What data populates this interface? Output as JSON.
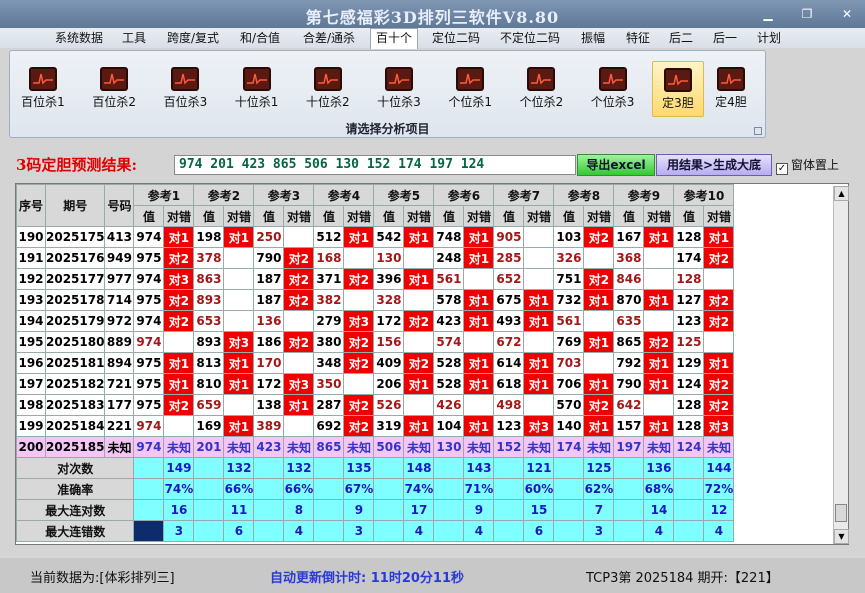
{
  "window": {
    "title": "第七感福彩3D排列三软件V8.80"
  },
  "menu": [
    "系统数据",
    "工具",
    "跨度/复式",
    "和/合值",
    "合差/通杀",
    "百十个",
    "定位二码",
    "不定位二码",
    "振幅",
    "特征",
    "后二",
    "后一",
    "计划"
  ],
  "menu_active": "百十个",
  "ribbon": {
    "buttons": [
      "百位杀1",
      "百位杀2",
      "百位杀3",
      "十位杀1",
      "十位杀2",
      "十位杀3",
      "个位杀1",
      "个位杀2",
      "个位杀3",
      "定3胆",
      "定4胆"
    ],
    "selected": "定3胆",
    "caption": "请选择分析项目"
  },
  "prediction": {
    "label": "3码定胆预测结果:",
    "value": "974 201 423 865 506 130 152 174 197 124",
    "export_label": "导出excel",
    "generate_label": "用结果>生成大底",
    "ontop_label": "窗体置上",
    "ontop_checked": "✓"
  },
  "table": {
    "head_idx": "序号",
    "head_period": "期号",
    "head_num": "号码",
    "refs": [
      "参考1",
      "参考2",
      "参考3",
      "参考4",
      "参考5",
      "参考6",
      "参考7",
      "参考8",
      "参考9",
      "参考10"
    ],
    "sub_val": "值",
    "sub_hit": "对错",
    "rows": [
      {
        "idx": "190",
        "period": "2025175",
        "num": "413",
        "cells": [
          [
            "974",
            "对1",
            0
          ],
          [
            "198",
            "对1",
            0
          ],
          [
            "250",
            "",
            1
          ],
          [
            "512",
            "对1",
            0
          ],
          [
            "542",
            "对1",
            0
          ],
          [
            "748",
            "对1",
            0
          ],
          [
            "905",
            "",
            1
          ],
          [
            "103",
            "对2",
            0
          ],
          [
            "167",
            "对1",
            0
          ],
          [
            "128",
            "对1",
            0
          ]
        ]
      },
      {
        "idx": "191",
        "period": "2025176",
        "num": "949",
        "cells": [
          [
            "975",
            "对2",
            0
          ],
          [
            "378",
            "",
            1
          ],
          [
            "790",
            "对2",
            0
          ],
          [
            "168",
            "",
            1
          ],
          [
            "130",
            "",
            1
          ],
          [
            "248",
            "对1",
            0
          ],
          [
            "285",
            "",
            1
          ],
          [
            "326",
            "",
            1
          ],
          [
            "368",
            "",
            1
          ],
          [
            "174",
            "对2",
            0
          ]
        ]
      },
      {
        "idx": "192",
        "period": "2025177",
        "num": "977",
        "cells": [
          [
            "974",
            "对3",
            0
          ],
          [
            "863",
            "",
            1
          ],
          [
            "187",
            "对2",
            0
          ],
          [
            "371",
            "对2",
            0
          ],
          [
            "396",
            "对1",
            0
          ],
          [
            "561",
            "",
            1
          ],
          [
            "652",
            "",
            1
          ],
          [
            "751",
            "对2",
            0
          ],
          [
            "846",
            "",
            1
          ],
          [
            "128",
            "",
            1
          ]
        ]
      },
      {
        "idx": "193",
        "period": "2025178",
        "num": "714",
        "cells": [
          [
            "975",
            "对2",
            0
          ],
          [
            "893",
            "",
            1
          ],
          [
            "187",
            "对2",
            0
          ],
          [
            "382",
            "",
            1
          ],
          [
            "328",
            "",
            1
          ],
          [
            "578",
            "对1",
            0
          ],
          [
            "675",
            "对1",
            0
          ],
          [
            "732",
            "对1",
            0
          ],
          [
            "870",
            "对1",
            0
          ],
          [
            "127",
            "对2",
            0
          ]
        ]
      },
      {
        "idx": "194",
        "period": "2025179",
        "num": "972",
        "cells": [
          [
            "974",
            "对2",
            0
          ],
          [
            "653",
            "",
            1
          ],
          [
            "136",
            "",
            1
          ],
          [
            "279",
            "对3",
            0
          ],
          [
            "172",
            "对2",
            0
          ],
          [
            "423",
            "对1",
            0
          ],
          [
            "493",
            "对1",
            0
          ],
          [
            "561",
            "",
            1
          ],
          [
            "635",
            "",
            1
          ],
          [
            "123",
            "对2",
            0
          ]
        ]
      },
      {
        "idx": "195",
        "period": "2025180",
        "num": "889",
        "cells": [
          [
            "974",
            "",
            1
          ],
          [
            "893",
            "对3",
            0
          ],
          [
            "186",
            "对2",
            0
          ],
          [
            "380",
            "对2",
            0
          ],
          [
            "156",
            "",
            1
          ],
          [
            "574",
            "",
            1
          ],
          [
            "672",
            "",
            1
          ],
          [
            "769",
            "对1",
            0
          ],
          [
            "865",
            "对2",
            0
          ],
          [
            "125",
            "",
            1
          ]
        ]
      },
      {
        "idx": "196",
        "period": "2025181",
        "num": "894",
        "cells": [
          [
            "975",
            "对1",
            0
          ],
          [
            "813",
            "对1",
            0
          ],
          [
            "170",
            "",
            1
          ],
          [
            "348",
            "对2",
            0
          ],
          [
            "409",
            "对2",
            0
          ],
          [
            "528",
            "对1",
            0
          ],
          [
            "614",
            "对1",
            0
          ],
          [
            "703",
            "",
            1
          ],
          [
            "792",
            "对1",
            0
          ],
          [
            "129",
            "对1",
            0
          ]
        ]
      },
      {
        "idx": "197",
        "period": "2025182",
        "num": "721",
        "cells": [
          [
            "975",
            "对1",
            0
          ],
          [
            "810",
            "对1",
            0
          ],
          [
            "172",
            "对3",
            0
          ],
          [
            "350",
            "",
            1
          ],
          [
            "206",
            "对1",
            0
          ],
          [
            "528",
            "对1",
            0
          ],
          [
            "618",
            "对1",
            0
          ],
          [
            "706",
            "对1",
            0
          ],
          [
            "790",
            "对1",
            0
          ],
          [
            "124",
            "对2",
            0
          ]
        ]
      },
      {
        "idx": "198",
        "period": "2025183",
        "num": "177",
        "cells": [
          [
            "975",
            "对2",
            0
          ],
          [
            "659",
            "",
            1
          ],
          [
            "138",
            "对1",
            0
          ],
          [
            "287",
            "对2",
            0
          ],
          [
            "526",
            "",
            1
          ],
          [
            "426",
            "",
            1
          ],
          [
            "498",
            "",
            1
          ],
          [
            "570",
            "对2",
            0
          ],
          [
            "642",
            "",
            1
          ],
          [
            "128",
            "对2",
            0
          ]
        ]
      },
      {
        "idx": "199",
        "period": "2025184",
        "num": "221",
        "cells": [
          [
            "974",
            "",
            1
          ],
          [
            "169",
            "对1",
            0
          ],
          [
            "389",
            "",
            1
          ],
          [
            "692",
            "对2",
            0
          ],
          [
            "319",
            "对1",
            0
          ],
          [
            "104",
            "对1",
            0
          ],
          [
            "123",
            "对3",
            0
          ],
          [
            "140",
            "对1",
            0
          ],
          [
            "157",
            "对1",
            0
          ],
          [
            "128",
            "对3",
            0
          ]
        ]
      }
    ],
    "pending": {
      "idx": "200",
      "period": "2025185",
      "num": "未知",
      "vals": [
        "974",
        "201",
        "423",
        "865",
        "506",
        "130",
        "152",
        "174",
        "197",
        "124"
      ],
      "hit": "未知"
    },
    "stats": [
      {
        "label": "对次数",
        "vals": [
          "149",
          "132",
          "132",
          "135",
          "148",
          "143",
          "121",
          "125",
          "136",
          "144"
        ]
      },
      {
        "label": "准确率",
        "vals": [
          "74%",
          "66%",
          "66%",
          "67%",
          "74%",
          "71%",
          "60%",
          "62%",
          "68%",
          "72%"
        ]
      },
      {
        "label": "最大连对数",
        "vals": [
          "16",
          "11",
          "8",
          "9",
          "17",
          "9",
          "15",
          "7",
          "14",
          "12"
        ]
      },
      {
        "label": "最大连错数",
        "vals": [
          "3",
          "6",
          "4",
          "3",
          "4",
          "4",
          "6",
          "3",
          "4",
          "4"
        ]
      }
    ]
  },
  "status": {
    "source": "当前数据为:[体彩排列三]",
    "countdown": "自动更新倒计时:  11时20分11秒",
    "draw": "TCP3第  2025184  期开:【221】"
  }
}
